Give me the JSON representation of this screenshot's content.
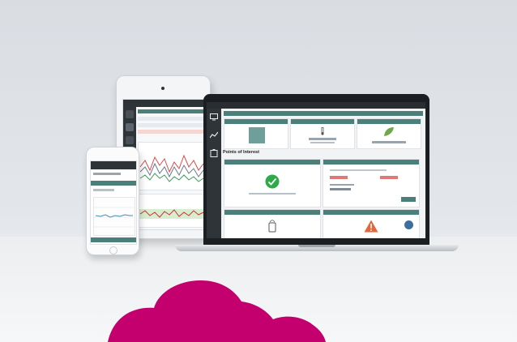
{
  "colors": {
    "cloud": "#c4006f",
    "accent_header": "#4a7f7a",
    "dark_chrome": "#2a2e33",
    "check_green": "#2eaa4a",
    "warning_orange": "#e4663a",
    "leaf_green": "#6ea84a",
    "fab_blue": "#3d6e9c"
  },
  "laptop": {
    "section_heading": "Points of Interest"
  },
  "icons": [
    "monitor-icon",
    "chart-line-icon",
    "clipboard-icon",
    "check-circle-icon",
    "warning-triangle-icon",
    "leaf-icon",
    "thermometer-icon",
    "chat-bubble-icon"
  ]
}
